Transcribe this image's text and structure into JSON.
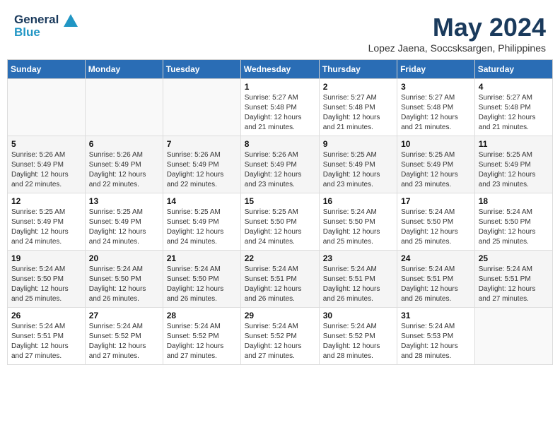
{
  "header": {
    "logo_line1": "General",
    "logo_line2": "Blue",
    "month": "May 2024",
    "location": "Lopez Jaena, Soccsksargen, Philippines"
  },
  "days_of_week": [
    "Sunday",
    "Monday",
    "Tuesday",
    "Wednesday",
    "Thursday",
    "Friday",
    "Saturday"
  ],
  "weeks": [
    [
      {
        "day": "",
        "info": ""
      },
      {
        "day": "",
        "info": ""
      },
      {
        "day": "",
        "info": ""
      },
      {
        "day": "1",
        "info": "Sunrise: 5:27 AM\nSunset: 5:48 PM\nDaylight: 12 hours\nand 21 minutes."
      },
      {
        "day": "2",
        "info": "Sunrise: 5:27 AM\nSunset: 5:48 PM\nDaylight: 12 hours\nand 21 minutes."
      },
      {
        "day": "3",
        "info": "Sunrise: 5:27 AM\nSunset: 5:48 PM\nDaylight: 12 hours\nand 21 minutes."
      },
      {
        "day": "4",
        "info": "Sunrise: 5:27 AM\nSunset: 5:48 PM\nDaylight: 12 hours\nand 21 minutes."
      }
    ],
    [
      {
        "day": "5",
        "info": "Sunrise: 5:26 AM\nSunset: 5:49 PM\nDaylight: 12 hours\nand 22 minutes."
      },
      {
        "day": "6",
        "info": "Sunrise: 5:26 AM\nSunset: 5:49 PM\nDaylight: 12 hours\nand 22 minutes."
      },
      {
        "day": "7",
        "info": "Sunrise: 5:26 AM\nSunset: 5:49 PM\nDaylight: 12 hours\nand 22 minutes."
      },
      {
        "day": "8",
        "info": "Sunrise: 5:26 AM\nSunset: 5:49 PM\nDaylight: 12 hours\nand 23 minutes."
      },
      {
        "day": "9",
        "info": "Sunrise: 5:25 AM\nSunset: 5:49 PM\nDaylight: 12 hours\nand 23 minutes."
      },
      {
        "day": "10",
        "info": "Sunrise: 5:25 AM\nSunset: 5:49 PM\nDaylight: 12 hours\nand 23 minutes."
      },
      {
        "day": "11",
        "info": "Sunrise: 5:25 AM\nSunset: 5:49 PM\nDaylight: 12 hours\nand 23 minutes."
      }
    ],
    [
      {
        "day": "12",
        "info": "Sunrise: 5:25 AM\nSunset: 5:49 PM\nDaylight: 12 hours\nand 24 minutes."
      },
      {
        "day": "13",
        "info": "Sunrise: 5:25 AM\nSunset: 5:49 PM\nDaylight: 12 hours\nand 24 minutes."
      },
      {
        "day": "14",
        "info": "Sunrise: 5:25 AM\nSunset: 5:49 PM\nDaylight: 12 hours\nand 24 minutes."
      },
      {
        "day": "15",
        "info": "Sunrise: 5:25 AM\nSunset: 5:50 PM\nDaylight: 12 hours\nand 24 minutes."
      },
      {
        "day": "16",
        "info": "Sunrise: 5:24 AM\nSunset: 5:50 PM\nDaylight: 12 hours\nand 25 minutes."
      },
      {
        "day": "17",
        "info": "Sunrise: 5:24 AM\nSunset: 5:50 PM\nDaylight: 12 hours\nand 25 minutes."
      },
      {
        "day": "18",
        "info": "Sunrise: 5:24 AM\nSunset: 5:50 PM\nDaylight: 12 hours\nand 25 minutes."
      }
    ],
    [
      {
        "day": "19",
        "info": "Sunrise: 5:24 AM\nSunset: 5:50 PM\nDaylight: 12 hours\nand 25 minutes."
      },
      {
        "day": "20",
        "info": "Sunrise: 5:24 AM\nSunset: 5:50 PM\nDaylight: 12 hours\nand 26 minutes."
      },
      {
        "day": "21",
        "info": "Sunrise: 5:24 AM\nSunset: 5:50 PM\nDaylight: 12 hours\nand 26 minutes."
      },
      {
        "day": "22",
        "info": "Sunrise: 5:24 AM\nSunset: 5:51 PM\nDaylight: 12 hours\nand 26 minutes."
      },
      {
        "day": "23",
        "info": "Sunrise: 5:24 AM\nSunset: 5:51 PM\nDaylight: 12 hours\nand 26 minutes."
      },
      {
        "day": "24",
        "info": "Sunrise: 5:24 AM\nSunset: 5:51 PM\nDaylight: 12 hours\nand 26 minutes."
      },
      {
        "day": "25",
        "info": "Sunrise: 5:24 AM\nSunset: 5:51 PM\nDaylight: 12 hours\nand 27 minutes."
      }
    ],
    [
      {
        "day": "26",
        "info": "Sunrise: 5:24 AM\nSunset: 5:51 PM\nDaylight: 12 hours\nand 27 minutes."
      },
      {
        "day": "27",
        "info": "Sunrise: 5:24 AM\nSunset: 5:52 PM\nDaylight: 12 hours\nand 27 minutes."
      },
      {
        "day": "28",
        "info": "Sunrise: 5:24 AM\nSunset: 5:52 PM\nDaylight: 12 hours\nand 27 minutes."
      },
      {
        "day": "29",
        "info": "Sunrise: 5:24 AM\nSunset: 5:52 PM\nDaylight: 12 hours\nand 27 minutes."
      },
      {
        "day": "30",
        "info": "Sunrise: 5:24 AM\nSunset: 5:52 PM\nDaylight: 12 hours\nand 28 minutes."
      },
      {
        "day": "31",
        "info": "Sunrise: 5:24 AM\nSunset: 5:53 PM\nDaylight: 12 hours\nand 28 minutes."
      },
      {
        "day": "",
        "info": ""
      }
    ]
  ]
}
